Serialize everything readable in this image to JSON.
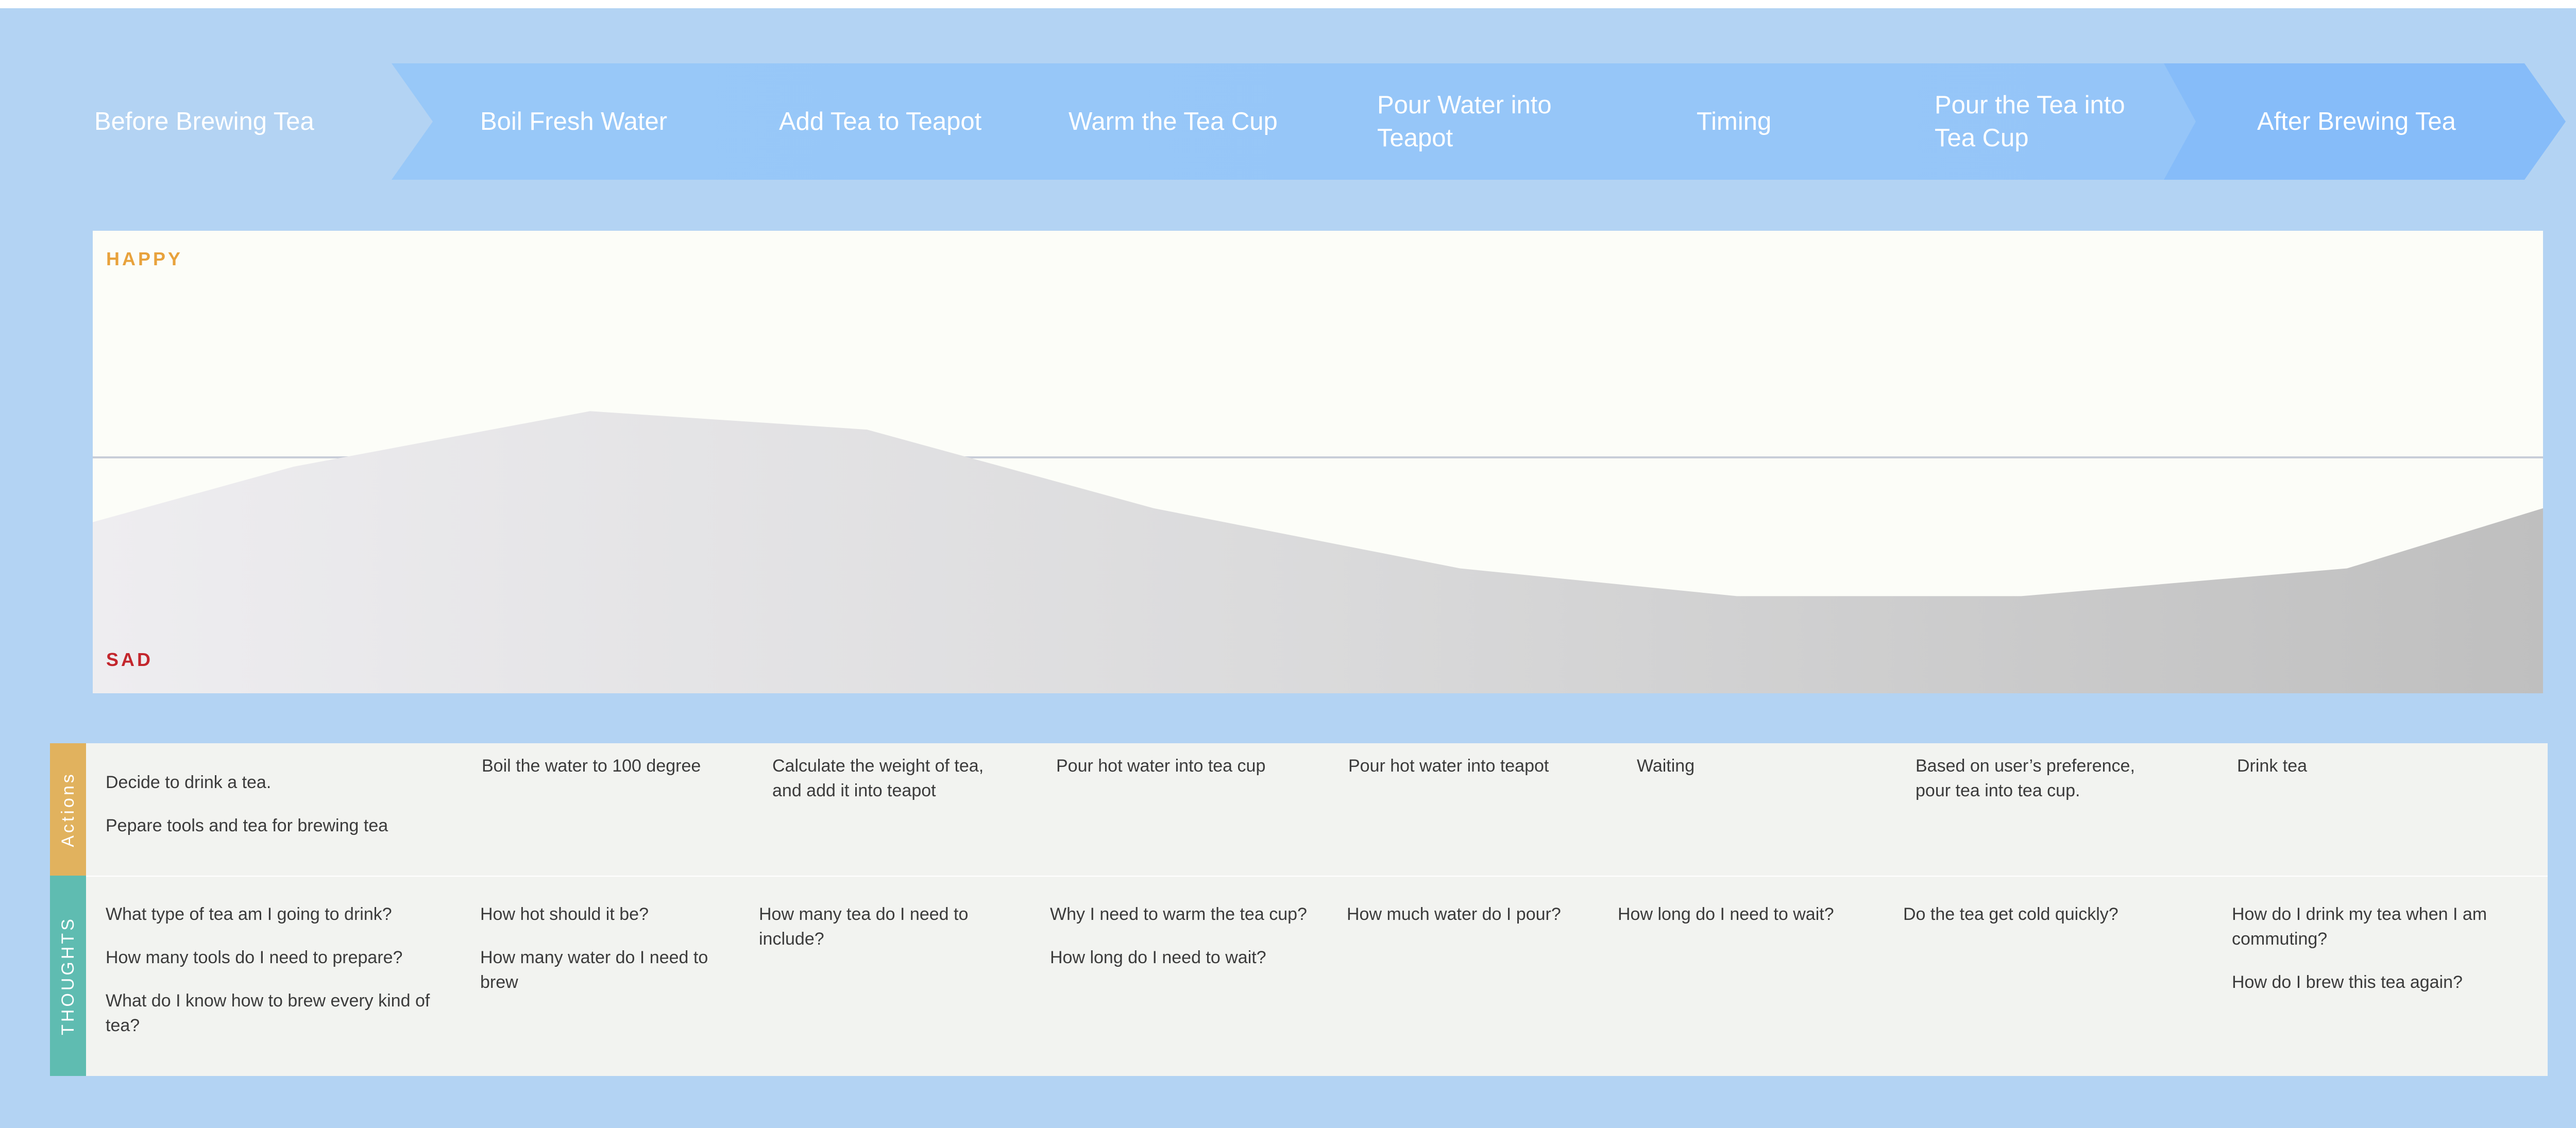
{
  "stages": [
    "Before Brewing Tea",
    "Boil Fresh Water",
    "Add Tea to Teapot",
    "Warm the Tea Cup",
    "Pour Water into Teapot",
    "Timing",
    "Pour the Tea into Tea Cup",
    "After Brewing Tea"
  ],
  "emotion": {
    "top_label": "HAPPY",
    "bottom_label": "SAD",
    "scale": "0 = sad, 1 = happy",
    "curve": [
      0.37,
      0.49,
      0.61,
      0.57,
      0.4,
      0.27,
      0.21,
      0.21,
      0.27,
      0.4
    ],
    "colors": {
      "happy": "#e8a23c",
      "sad": "#c3262d"
    }
  },
  "lanes": {
    "actions_label": "Actions",
    "thoughts_label": "THOUGHTS",
    "actions": [
      [
        "Decide to drink a tea.",
        "Pepare tools and tea for brewing tea"
      ],
      [
        "Boil the water to 100 degree"
      ],
      [
        "Calculate the weight of tea, and add it into teapot"
      ],
      [
        "Pour hot water into tea cup"
      ],
      [
        "Pour hot water into teapot"
      ],
      [
        "Waiting"
      ],
      [
        "Based on user’s preference, pour tea into tea cup."
      ],
      [
        "Drink tea"
      ]
    ],
    "thoughts": [
      [
        "What type of tea am I going to drink?",
        "How many tools do I need to prepare?",
        "What do I know how to brew every kind of tea?"
      ],
      [
        "How hot should it be?",
        "How many water do I need to brew"
      ],
      [
        "How many tea do I need to include?"
      ],
      [
        "Why I need to warm the tea cup?",
        "How long do I need to wait?"
      ],
      [
        "How much water do I pour?"
      ],
      [
        "How long do I need to wait?"
      ],
      [
        "Do the tea get cold quickly?"
      ],
      [
        "How do I drink my tea when I am commuting?",
        "How do I brew this tea again?"
      ]
    ]
  },
  "colors": {
    "background": "#b3d3f3",
    "ribbon": "#98c8f8",
    "ribbon_last": "#86bcf9",
    "actions_tab": "#e1b25e",
    "thoughts_tab": "#5fbcb1"
  }
}
